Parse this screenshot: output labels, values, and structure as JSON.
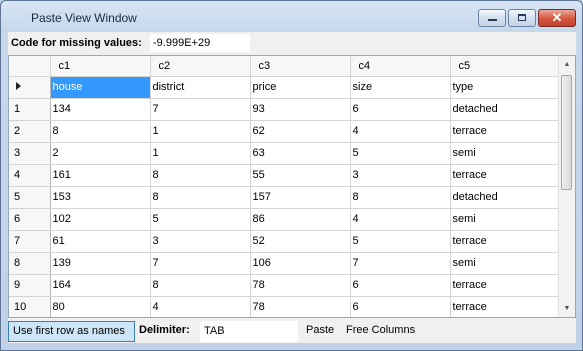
{
  "window": {
    "title": "Paste View Window"
  },
  "missing": {
    "label": "Code for missing values:",
    "value": "-9.999E+29"
  },
  "grid": {
    "columns": [
      "c1",
      "c2",
      "c3",
      "c4",
      "c5"
    ],
    "rows": [
      {
        "header": "",
        "cells": [
          "house",
          "district",
          "price",
          "size",
          "type"
        ]
      },
      {
        "header": "1",
        "cells": [
          "134",
          "7",
          "93",
          "6",
          "detached"
        ]
      },
      {
        "header": "2",
        "cells": [
          "8",
          "1",
          "62",
          "4",
          "terrace"
        ]
      },
      {
        "header": "3",
        "cells": [
          "2",
          "1",
          "63",
          "5",
          "semi"
        ]
      },
      {
        "header": "4",
        "cells": [
          "161",
          "8",
          "55",
          "3",
          "terrace"
        ]
      },
      {
        "header": "5",
        "cells": [
          "153",
          "8",
          "157",
          "8",
          "detached"
        ]
      },
      {
        "header": "6",
        "cells": [
          "102",
          "5",
          "86",
          "4",
          "semi"
        ]
      },
      {
        "header": "7",
        "cells": [
          "61",
          "3",
          "52",
          "5",
          "terrace"
        ]
      },
      {
        "header": "8",
        "cells": [
          "139",
          "7",
          "106",
          "7",
          "semi"
        ]
      },
      {
        "header": "9",
        "cells": [
          "164",
          "8",
          "78",
          "6",
          "terrace"
        ]
      },
      {
        "header": "10",
        "cells": [
          "80",
          "4",
          "78",
          "6",
          "terrace"
        ]
      }
    ]
  },
  "bottom": {
    "first_row_button": "Use first row as names",
    "delimiter_label": "Delimiter:",
    "delimiter_value": "TAB",
    "paste_label": "Paste",
    "free_columns": "Free Columns"
  },
  "icons": {
    "minimize": "minimize-icon",
    "maximize": "maximize-icon",
    "close": "close-icon",
    "current_row": "current-row-arrow-icon"
  }
}
